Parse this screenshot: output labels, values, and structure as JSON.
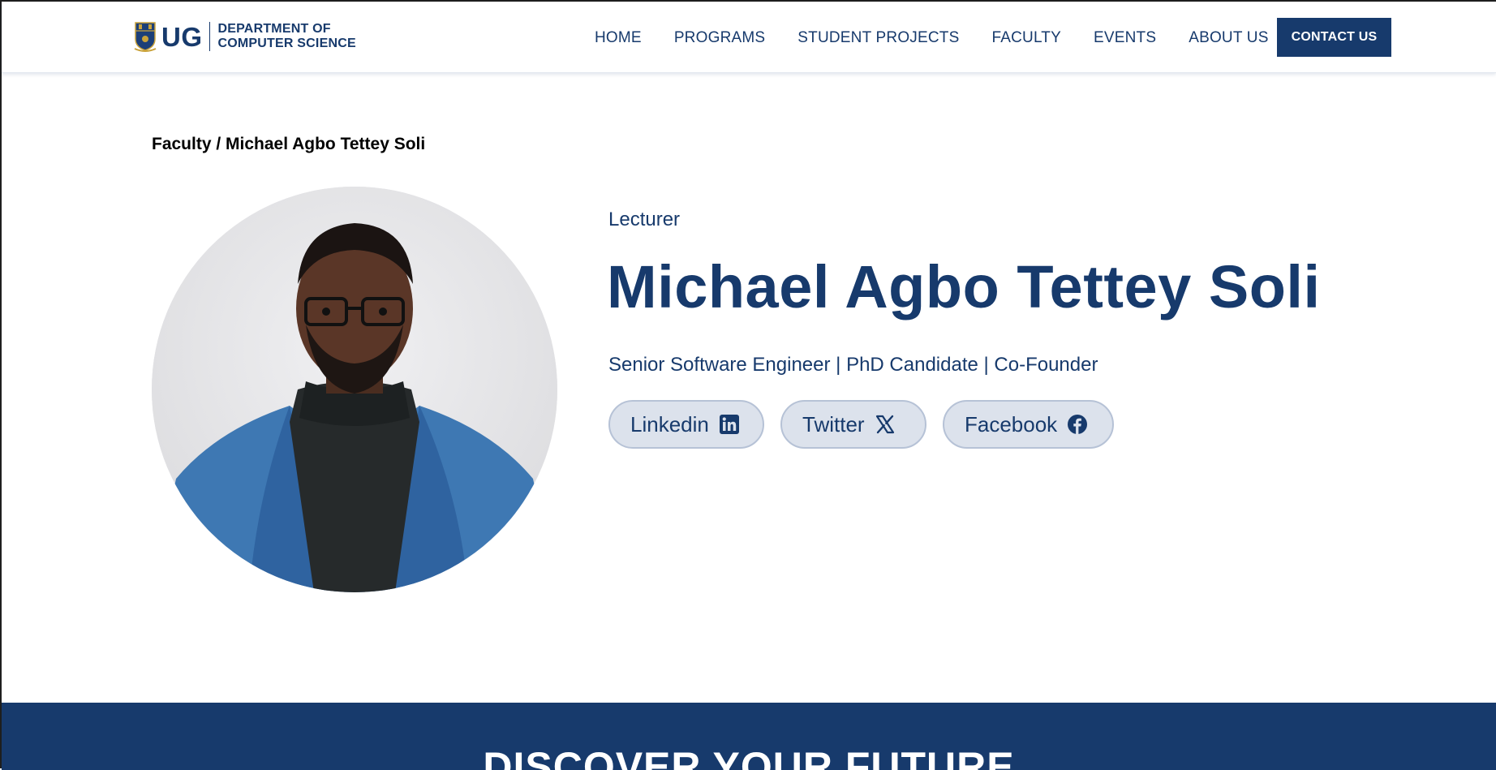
{
  "header": {
    "logo": {
      "short": "UG",
      "dept_line1": "DEPARTMENT OF",
      "dept_line2": "COMPUTER SCIENCE",
      "crest_icon": "university-crest-icon"
    },
    "nav": [
      "HOME",
      "PROGRAMS",
      "STUDENT PROJECTS",
      "FACULTY",
      "EVENTS",
      "ABOUT US"
    ],
    "contact_label": "CONTACT US"
  },
  "breadcrumb": "Faculty / Michael Agbo Tettey Soli",
  "profile": {
    "role": "Lecturer",
    "name": "Michael Agbo Tettey Soli",
    "tagline": "Senior Software Engineer | PhD Candidate | Co-Founder",
    "socials": [
      {
        "label": "Linkedin",
        "icon": "linkedin-icon"
      },
      {
        "label": "Twitter",
        "icon": "x-twitter-icon"
      },
      {
        "label": "Facebook",
        "icon": "facebook-icon"
      }
    ]
  },
  "banner": {
    "title": "DISCOVER YOUR FUTURE"
  },
  "colors": {
    "primary": "#173a6c",
    "pill_bg": "#dce2ec",
    "pill_border": "#b6c2d6",
    "banner_text": "#ffffff"
  }
}
